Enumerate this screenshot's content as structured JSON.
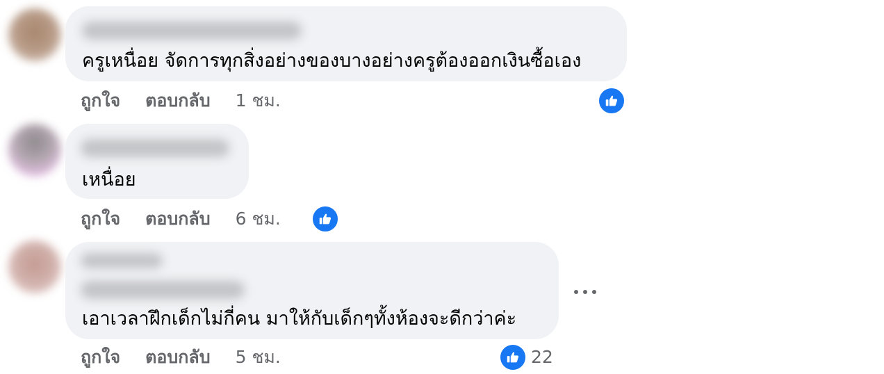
{
  "comments": [
    {
      "text": "ครูเหนื่อย จัดการทุกสิ่งอย่างของบางอย่างครูต้องออกเงินซื้อเอง",
      "like_label": "ถูกใจ",
      "reply_label": "ตอบกลับ",
      "time": "1 ชม.",
      "reaction_icon": "like-icon"
    },
    {
      "text": "เหนื่อย",
      "like_label": "ถูกใจ",
      "reply_label": "ตอบกลับ",
      "time": "6 ชม.",
      "reaction_icon": "like-icon"
    },
    {
      "text": "เอาเวลาฝึกเด็กไม่กี่คน มาให้กับเด็กๆทั้งห้องจะดีกว่าค่ะ",
      "like_label": "ถูกใจ",
      "reply_label": "ตอบกลับ",
      "time": "5 ชม.",
      "reaction_icon": "like-icon",
      "reaction_count": "22",
      "more_icon": "more-options-icon"
    }
  ],
  "colors": {
    "bubble": "#f0f2f5",
    "like_blue": "#1877f2",
    "meta_text": "#65676b",
    "body_text": "#050505"
  }
}
